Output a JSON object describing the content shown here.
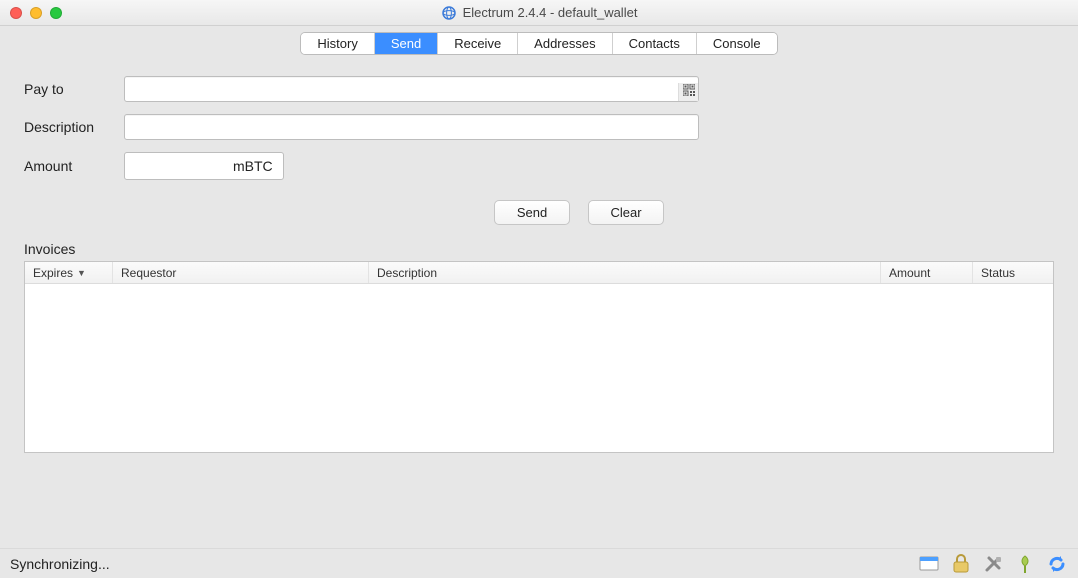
{
  "window": {
    "title": "Electrum 2.4.4  -  default_wallet"
  },
  "tabs": {
    "history": "History",
    "send": "Send",
    "receive": "Receive",
    "addresses": "Addresses",
    "contacts": "Contacts",
    "console": "Console",
    "active": "send"
  },
  "form": {
    "payto_label": "Pay to",
    "payto_value": "",
    "description_label": "Description",
    "description_value": "",
    "amount_label": "Amount",
    "amount_value": "",
    "amount_unit": "mBTC"
  },
  "buttons": {
    "send": "Send",
    "clear": "Clear"
  },
  "invoices": {
    "heading": "Invoices",
    "columns": {
      "expires": "Expires",
      "requestor": "Requestor",
      "description": "Description",
      "amount": "Amount",
      "status": "Status"
    },
    "sort_column": "expires",
    "sort_desc": true,
    "rows": []
  },
  "statusbar": {
    "text": "Synchronizing..."
  }
}
